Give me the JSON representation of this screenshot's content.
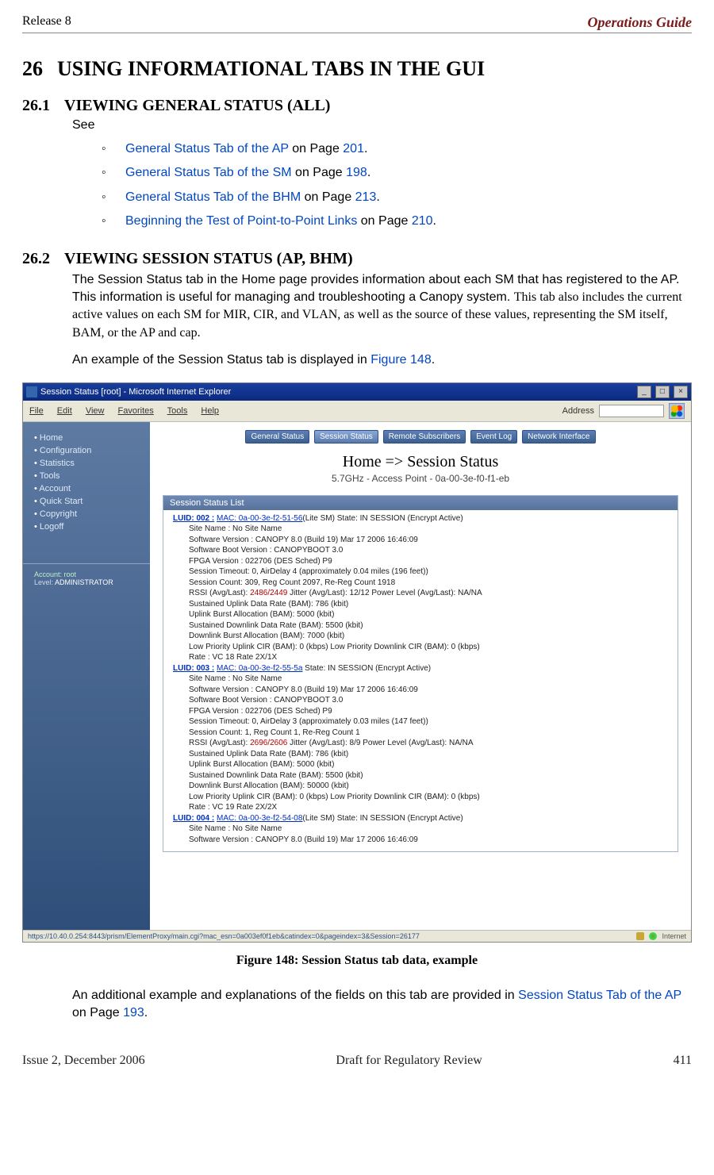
{
  "header": {
    "left": "Release 8",
    "right": "Operations Guide"
  },
  "h1": {
    "num": "26",
    "title": "USING INFORMATIONAL TABS IN THE GUI"
  },
  "s1": {
    "num": "26.1",
    "title": "VIEWING GENERAL STATUS (ALL)",
    "see": "See",
    "items": [
      {
        "link": "General Status Tab of the AP",
        "mid": " on Page ",
        "pg": "201",
        "end": "."
      },
      {
        "link": "General Status Tab of the SM",
        "mid": " on Page ",
        "pg": "198",
        "end": "."
      },
      {
        "link": "General Status Tab of the BHM",
        "mid": " on Page ",
        "pg": "213",
        "end": "."
      },
      {
        "link": "Beginning the Test of Point-to-Point Links",
        "mid": " on Page ",
        "pg": "210",
        "end": "."
      }
    ]
  },
  "s2": {
    "num": "26.2",
    "title": "VIEWING SESSION STATUS (AP, BHM)",
    "p1a": "The Session Status tab in the Home page provides information about each SM that has registered to the AP. This information is useful for managing and troubleshooting a Canopy system. ",
    "p1b": "This tab also includes the current active values on each SM for MIR, CIR, and VLAN, as well as the source of these values, representing the SM itself, BAM, or the AP and cap.",
    "p2a": "An example of the Session Status tab is displayed in ",
    "p2link": "Figure 148",
    "p2b": "."
  },
  "shot": {
    "title": "Session Status [root] - Microsoft Internet Explorer",
    "menus": [
      "File",
      "Edit",
      "View",
      "Favorites",
      "Tools",
      "Help"
    ],
    "address_label": "Address",
    "sidebar": [
      "Home",
      "Configuration",
      "Statistics",
      "Tools",
      "Account",
      "Quick Start",
      "Copyright",
      "Logoff"
    ],
    "login": {
      "acct_label": "Account:",
      "acct": "root",
      "level_label": "Level:",
      "level": "ADMINISTRATOR"
    },
    "tabs": [
      "General Status",
      "Session Status",
      "Remote Subscribers",
      "Event Log",
      "Network Interface"
    ],
    "home_title": "Home => Session Status",
    "sub_title": "5.7GHz - Access Point - 0a-00-3e-f0-f1-eb",
    "log_head": "Session Status List",
    "entries": [
      {
        "luid": "LUID: 002 :",
        "mac": "MAC: 0a-00-3e-f2-51-56",
        "suffix": "(Lite SM) State: IN SESSION (Encrypt Active)",
        "lines": [
          "Site Name : No Site Name",
          "Software Version : CANOPY 8.0 (Build 19) Mar 17 2006 16:46:09",
          "Software Boot Version : CANOPYBOOT 3.0",
          "FPGA Version : 022706 (DES Sched) P9",
          "Session Timeout: 0, AirDelay 4 (approximately 0.04 miles (196 feet))",
          "Session Count: 309, Reg Count 2097, Re-Reg Count 1918"
        ],
        "rssi_pre": "RSSI (Avg/Last): ",
        "rssi_val": "2486/2449",
        "rssi_post": "   Jitter (Avg/Last): 12/12   Power Level (Avg/Last): NA/NA",
        "lines2": [
          "Sustained Uplink Data Rate (BAM): 786 (kbit)",
          "Uplink Burst Allocation (BAM): 5000 (kbit)",
          "Sustained Downlink Data Rate (BAM): 5500 (kbit)",
          "Downlink Burst Allocation (BAM): 7000 (kbit)",
          "Low Priority Uplink CIR (BAM): 0 (kbps) Low Priority Downlink CIR (BAM): 0 (kbps)",
          "Rate : VC 18 Rate 2X/1X"
        ]
      },
      {
        "luid": "LUID: 003 :",
        "mac": "MAC: 0a-00-3e-f2-55-5a",
        "suffix": " State: IN SESSION (Encrypt Active)",
        "lines": [
          "Site Name : No Site Name",
          "Software Version : CANOPY 8.0 (Build 19) Mar 17 2006 16:46:09",
          "Software Boot Version : CANOPYBOOT 3.0",
          "FPGA Version : 022706 (DES Sched) P9",
          "Session Timeout: 0, AirDelay 3 (approximately 0.03 miles (147 feet))",
          "Session Count: 1, Reg Count 1, Re-Reg Count 1"
        ],
        "rssi_pre": "RSSI (Avg/Last): ",
        "rssi_val": "2696/2606",
        "rssi_post": "   Jitter (Avg/Last): 8/9   Power Level (Avg/Last): NA/NA",
        "lines2": [
          "Sustained Uplink Data Rate (BAM): 786 (kbit)",
          "Uplink Burst Allocation (BAM): 5000 (kbit)",
          "Sustained Downlink Data Rate (BAM): 5500 (kbit)",
          "Downlink Burst Allocation (BAM): 50000 (kbit)",
          "Low Priority Uplink CIR (BAM): 0 (kbps) Low Priority Downlink CIR (BAM): 0 (kbps)",
          "Rate : VC 19 Rate 2X/2X"
        ]
      },
      {
        "luid": "LUID: 004 :",
        "mac": "MAC: 0a-00-3e-f2-54-08",
        "suffix": "(Lite SM) State: IN SESSION (Encrypt Active)",
        "lines": [
          "Site Name : No Site Name",
          "Software Version : CANOPY 8.0 (Build 19) Mar 17 2006 16:46:09"
        ],
        "rssi_pre": "",
        "rssi_val": "",
        "rssi_post": "",
        "lines2": []
      }
    ],
    "statusbar_url": "https://10.40.0.254:8443/prism/ElementProxy/main.cgi?mac_esn=0a003ef0f1eb&catindex=0&pageindex=3&Session=26177",
    "zone": "Internet"
  },
  "caption": "Figure 148: Session Status tab data, example",
  "after": {
    "a": "An additional example and explanations of the fields on this tab are provided in ",
    "link": "Session Status Tab of the AP",
    "b": " on Page ",
    "pg": "193",
    "c": "."
  },
  "footer": {
    "left": "Issue 2, December 2006",
    "center": "Draft for Regulatory Review",
    "right": "411"
  }
}
